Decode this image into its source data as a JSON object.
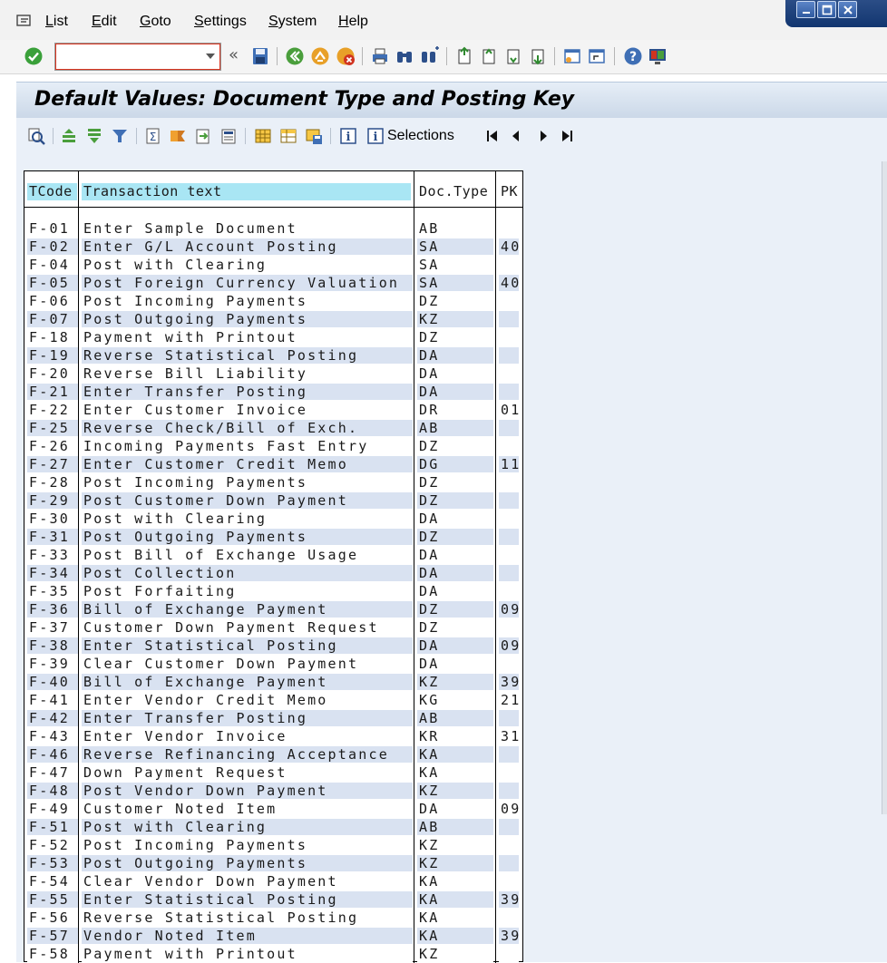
{
  "menubar": {
    "items": [
      {
        "label": "List",
        "u": "L",
        "rest": "ist"
      },
      {
        "label": "Edit",
        "u": "E",
        "rest": "dit"
      },
      {
        "label": "Goto",
        "u": "G",
        "rest": "oto"
      },
      {
        "label": "Settings",
        "u": "S",
        "rest": "ettings"
      },
      {
        "label": "System",
        "u": "S",
        "rest": "ystem"
      },
      {
        "label": "Help",
        "u": "H",
        "rest": "elp"
      }
    ]
  },
  "toolbar": {
    "command_field_value": "",
    "history_glyph": "«"
  },
  "page": {
    "title": "Default Values: Document Type and Posting Key"
  },
  "app_toolbar": {
    "selections_label": "Selections"
  },
  "table": {
    "headers": {
      "tcode": "TCode",
      "text": "Transaction text",
      "doctype": "Doc.Type",
      "pk": "PK"
    },
    "rows": [
      {
        "tcode": "F-01",
        "text": "Enter Sample Document",
        "doctype": "AB",
        "pk": ""
      },
      {
        "tcode": "F-02",
        "text": "Enter G/L Account Posting",
        "doctype": "SA",
        "pk": "40"
      },
      {
        "tcode": "F-04",
        "text": "Post with Clearing",
        "doctype": "SA",
        "pk": ""
      },
      {
        "tcode": "F-05",
        "text": "Post Foreign Currency Valuation",
        "doctype": "SA",
        "pk": "40"
      },
      {
        "tcode": "F-06",
        "text": "Post Incoming Payments",
        "doctype": "DZ",
        "pk": ""
      },
      {
        "tcode": "F-07",
        "text": "Post Outgoing Payments",
        "doctype": "KZ",
        "pk": ""
      },
      {
        "tcode": "F-18",
        "text": "Payment with Printout",
        "doctype": "DZ",
        "pk": ""
      },
      {
        "tcode": "F-19",
        "text": "Reverse Statistical Posting",
        "doctype": "DA",
        "pk": ""
      },
      {
        "tcode": "F-20",
        "text": "Reverse Bill Liability",
        "doctype": "DA",
        "pk": ""
      },
      {
        "tcode": "F-21",
        "text": "Enter Transfer Posting",
        "doctype": "DA",
        "pk": ""
      },
      {
        "tcode": "F-22",
        "text": "Enter Customer Invoice",
        "doctype": "DR",
        "pk": "01"
      },
      {
        "tcode": "F-25",
        "text": "Reverse Check/Bill of Exch.",
        "doctype": "AB",
        "pk": ""
      },
      {
        "tcode": "F-26",
        "text": "Incoming Payments Fast Entry",
        "doctype": "DZ",
        "pk": ""
      },
      {
        "tcode": "F-27",
        "text": "Enter Customer Credit Memo",
        "doctype": "DG",
        "pk": "11"
      },
      {
        "tcode": "F-28",
        "text": "Post Incoming Payments",
        "doctype": "DZ",
        "pk": ""
      },
      {
        "tcode": "F-29",
        "text": "Post Customer Down Payment",
        "doctype": "DZ",
        "pk": ""
      },
      {
        "tcode": "F-30",
        "text": "Post with Clearing",
        "doctype": "DA",
        "pk": ""
      },
      {
        "tcode": "F-31",
        "text": "Post Outgoing Payments",
        "doctype": "DZ",
        "pk": ""
      },
      {
        "tcode": "F-33",
        "text": "Post Bill of Exchange Usage",
        "doctype": "DA",
        "pk": ""
      },
      {
        "tcode": "F-34",
        "text": "Post Collection",
        "doctype": "DA",
        "pk": ""
      },
      {
        "tcode": "F-35",
        "text": "Post Forfaiting",
        "doctype": "DA",
        "pk": ""
      },
      {
        "tcode": "F-36",
        "text": "Bill of Exchange Payment",
        "doctype": "DZ",
        "pk": "09"
      },
      {
        "tcode": "F-37",
        "text": "Customer Down Payment Request",
        "doctype": "DZ",
        "pk": ""
      },
      {
        "tcode": "F-38",
        "text": "Enter Statistical Posting",
        "doctype": "DA",
        "pk": "09"
      },
      {
        "tcode": "F-39",
        "text": "Clear Customer Down Payment",
        "doctype": "DA",
        "pk": ""
      },
      {
        "tcode": "F-40",
        "text": "Bill of Exchange Payment",
        "doctype": "KZ",
        "pk": "39"
      },
      {
        "tcode": "F-41",
        "text": "Enter Vendor Credit Memo",
        "doctype": "KG",
        "pk": "21"
      },
      {
        "tcode": "F-42",
        "text": "Enter Transfer Posting",
        "doctype": "AB",
        "pk": ""
      },
      {
        "tcode": "F-43",
        "text": "Enter Vendor Invoice",
        "doctype": "KR",
        "pk": "31"
      },
      {
        "tcode": "F-46",
        "text": "Reverse Refinancing Acceptance",
        "doctype": "KA",
        "pk": ""
      },
      {
        "tcode": "F-47",
        "text": "Down Payment Request",
        "doctype": "KA",
        "pk": ""
      },
      {
        "tcode": "F-48",
        "text": "Post Vendor Down Payment",
        "doctype": "KZ",
        "pk": ""
      },
      {
        "tcode": "F-49",
        "text": "Customer Noted Item",
        "doctype": "DA",
        "pk": "09"
      },
      {
        "tcode": "F-51",
        "text": "Post with Clearing",
        "doctype": "AB",
        "pk": ""
      },
      {
        "tcode": "F-52",
        "text": "Post Incoming Payments",
        "doctype": "KZ",
        "pk": ""
      },
      {
        "tcode": "F-53",
        "text": "Post Outgoing Payments",
        "doctype": "KZ",
        "pk": ""
      },
      {
        "tcode": "F-54",
        "text": "Clear Vendor Down Payment",
        "doctype": "KA",
        "pk": ""
      },
      {
        "tcode": "F-55",
        "text": "Enter Statistical Posting",
        "doctype": "KA",
        "pk": "39"
      },
      {
        "tcode": "F-56",
        "text": "Reverse Statistical Posting",
        "doctype": "KA",
        "pk": ""
      },
      {
        "tcode": "F-57",
        "text": "Vendor Noted Item",
        "doctype": "KA",
        "pk": "39"
      },
      {
        "tcode": "F-58",
        "text": "Payment with Printout",
        "doctype": "KZ",
        "pk": ""
      }
    ]
  },
  "colors": {
    "header_cell": "#a9e6f4",
    "alt_row": "#d9e2f1",
    "title_bg": "#cbd8e8",
    "window_controls": "#2f5aa0"
  }
}
